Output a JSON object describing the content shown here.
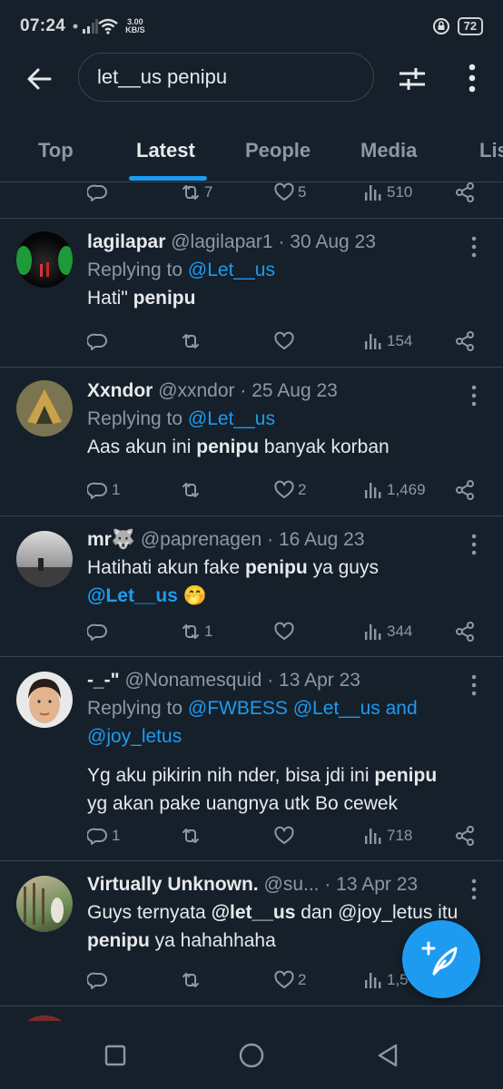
{
  "status_bar": {
    "time": "07:24",
    "speed_top": "3.00",
    "speed_bottom": "KB/S",
    "battery": "72"
  },
  "search": {
    "query": "let__us penipu"
  },
  "tabs": [
    "Top",
    "Latest",
    "People",
    "Media",
    "Lis"
  ],
  "active_tab": "Latest",
  "partial_tweet": {
    "retweets": "7",
    "likes": "5",
    "views": "510"
  },
  "tweets": [
    {
      "name": "lagilapar",
      "handle": "@lagilapar1",
      "date": "· 30 Aug 23",
      "replying_label": "Replying to",
      "replying_to": "@Let__us",
      "text_before": "Hati\" ",
      "text_bold": "penipu",
      "text_after": "",
      "replies": "",
      "retweets": "",
      "likes": "",
      "views": "154"
    },
    {
      "name": "Xxndor",
      "handle": "@xxndor",
      "date": "· 25 Aug 23",
      "replying_label": "Replying to",
      "replying_to": "@Let__us",
      "text_before": "Aas akun ini ",
      "text_bold": "penipu",
      "text_after": " banyak korban",
      "replies": "1",
      "retweets": "",
      "likes": "2",
      "views": "1,469"
    },
    {
      "name": "mr🐺",
      "handle": "@paprenagen",
      "date": "· 16 Aug 23",
      "text_before": "Hatihati akun fake ",
      "text_bold": "penipu",
      "text_after": " ya guys",
      "mention": "@Let__us",
      "emoji": "🤭",
      "replies": "",
      "retweets": "1",
      "likes": "",
      "views": "344"
    },
    {
      "name": "-_-\"",
      "handle": "@Nonamesquid",
      "date": "· 13 Apr 23",
      "replying_label": "Replying to",
      "replying_to_line1": "@FWBESS @Let__us and",
      "replying_to_line2": "@joy_letus",
      "text_line1_before": "Yg aku pikirin nih nder, bisa jdi ini ",
      "text_bold": "penipu",
      "text_line2": "yg akan pake uangnya utk Bo cewek",
      "replies": "1",
      "retweets": "",
      "likes": "",
      "views": "718"
    },
    {
      "name": "Virtually Unknown.",
      "handle": "@su...",
      "date": "· 13 Apr 23",
      "text_line1_before": "Guys ternyata ",
      "text_bold_mention": "@let__us",
      "text_line1_after": " dan @joy_letus itu",
      "text_bold": "penipu",
      "text_line2_after": " ya hahahhaha",
      "replies": "",
      "retweets": "",
      "likes": "2",
      "views": "1,5"
    }
  ],
  "colors": {
    "background": "#15202b",
    "accent": "#1d9bf0",
    "muted": "#8b98a5",
    "text": "#e7e9ea",
    "divider": "#38444d"
  }
}
